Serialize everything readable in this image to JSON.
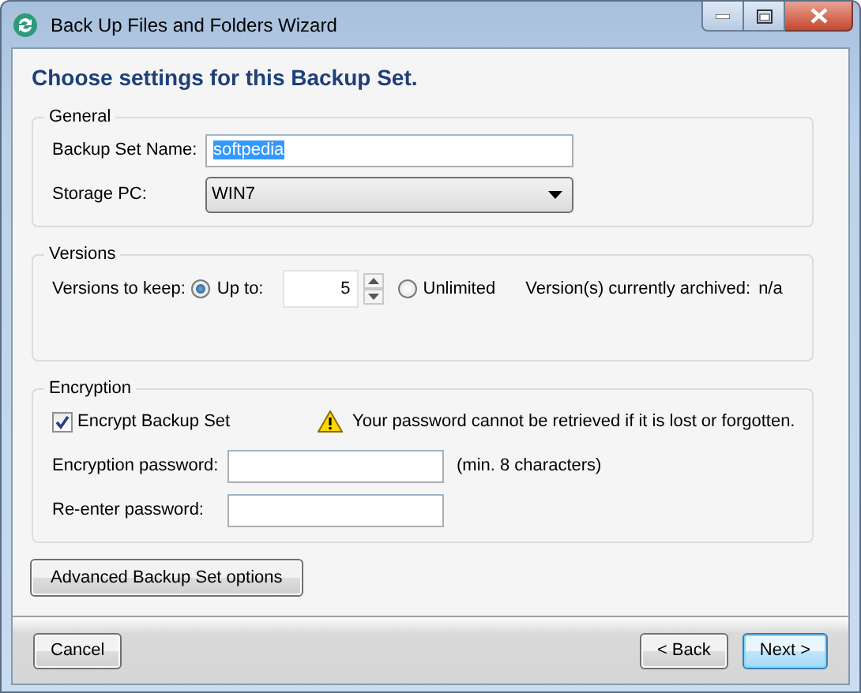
{
  "window": {
    "title": "Back Up Files and Folders Wizard"
  },
  "heading": "Choose settings for this Backup Set.",
  "general": {
    "title": "General",
    "name_label": "Backup Set Name:",
    "name_value": "softpedia",
    "name_value_selected": true,
    "storage_label": "Storage PC:",
    "storage_value": "WIN7"
  },
  "versions": {
    "title": "Versions",
    "label": "Versions to keep:",
    "options": [
      {
        "label": "Up to:",
        "selected": true
      },
      {
        "label": "Unlimited",
        "selected": false
      }
    ],
    "count": "5",
    "archived_label": "Version(s) currently archived:",
    "archived_value": "n/a"
  },
  "encryption": {
    "title": "Encryption",
    "encrypt": {
      "label": "Encrypt Backup Set",
      "checked": true
    },
    "warning": "Your password cannot be retrieved if it is lost or forgotten.",
    "password_label": "Encryption password:",
    "password_hint": "(min. 8 characters)",
    "reenter_label": "Re-enter password:"
  },
  "advanced_button": "Advanced Backup Set options",
  "buttons": [
    {
      "label": "Cancel",
      "focused": false
    },
    {
      "label": "< Back",
      "focused": false
    },
    {
      "label": "Next >",
      "focused": true
    }
  ]
}
